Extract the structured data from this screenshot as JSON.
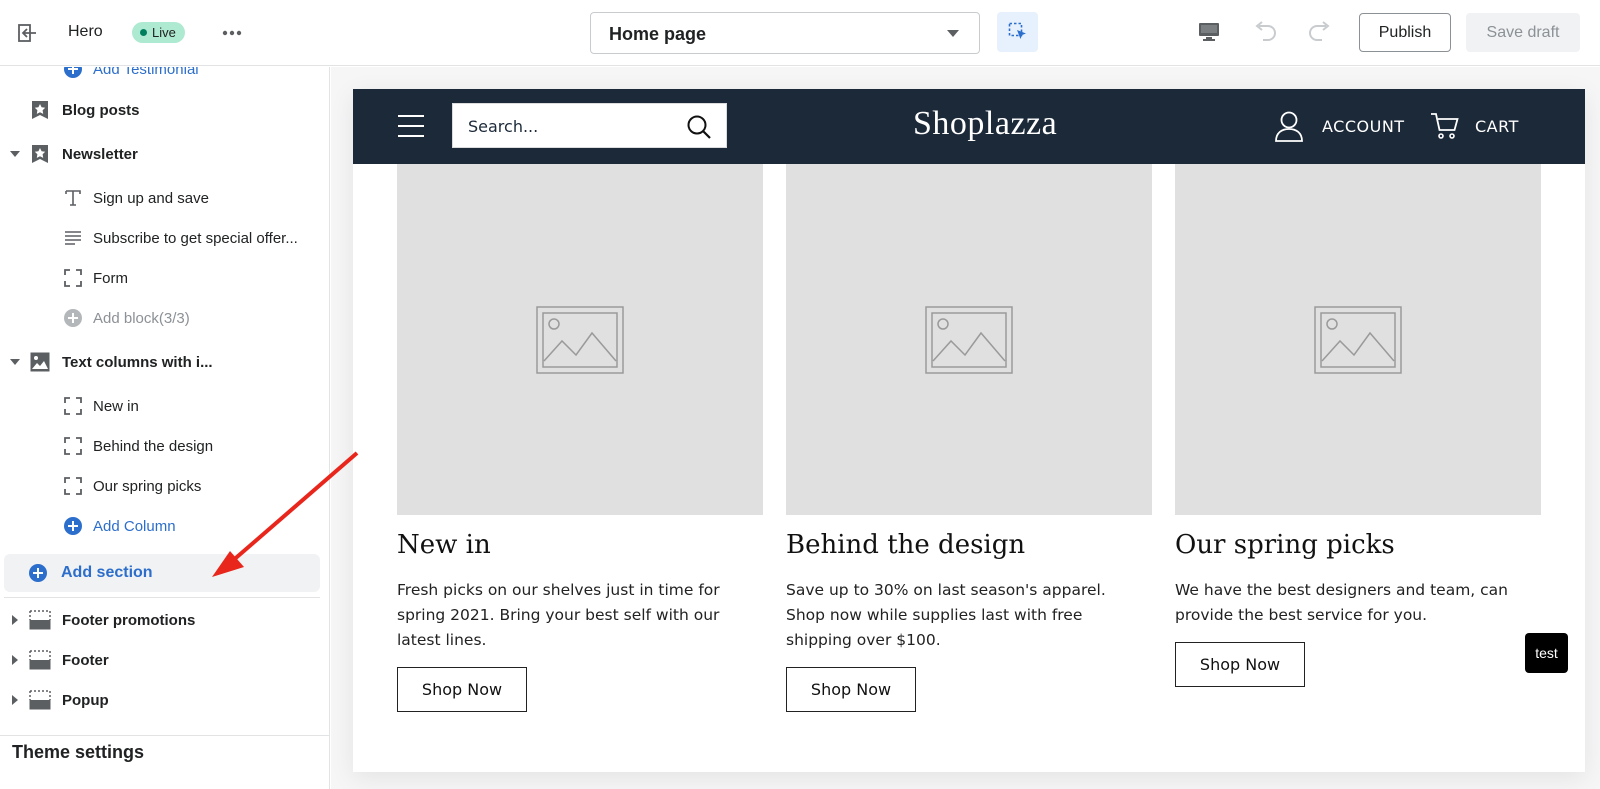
{
  "topbar": {
    "title": "Hero",
    "status": "Live",
    "page_select": "Home page",
    "publish_label": "Publish",
    "save_label": "Save draft"
  },
  "sidebar": {
    "partial_item": "Add Testimonial",
    "items": [
      {
        "label": "Blog posts"
      },
      {
        "label": "Newsletter"
      },
      {
        "label": "Sign up and save"
      },
      {
        "label": "Subscribe to get special offer..."
      },
      {
        "label": "Form"
      },
      {
        "label": "Add block(3/3)"
      },
      {
        "label": "Text columns with i..."
      },
      {
        "label": "New in"
      },
      {
        "label": "Behind the design"
      },
      {
        "label": "Our spring picks"
      },
      {
        "label": "Add Column"
      }
    ],
    "add_section": "Add section",
    "footer_sections": [
      {
        "label": "Footer promotions"
      },
      {
        "label": "Footer"
      },
      {
        "label": "Popup"
      }
    ],
    "theme_settings": "Theme settings"
  },
  "store": {
    "search_placeholder": "Search...",
    "brand": "Shoplazza",
    "account": "ACCOUNT",
    "cart": "CART",
    "columns": [
      {
        "title": "New in",
        "description": "Fresh picks on our shelves just in time for spring 2021. Bring your best self with our latest lines.",
        "button": "Shop Now"
      },
      {
        "title": "Behind the design",
        "description": "Save up to 30% on last season's apparel. Shop now while supplies last with free shipping over $100.",
        "button": "Shop Now"
      },
      {
        "title": "Our spring picks",
        "description": "We have the best designers and team, can provide the best service for you.",
        "button": "Shop Now"
      }
    ]
  },
  "floating": {
    "label": "test"
  },
  "colors": {
    "accent": "#2c6ecb",
    "header_bg": "#1c2939",
    "live_badge": "#aee9d1",
    "annotation_arrow": "#e8261c"
  }
}
